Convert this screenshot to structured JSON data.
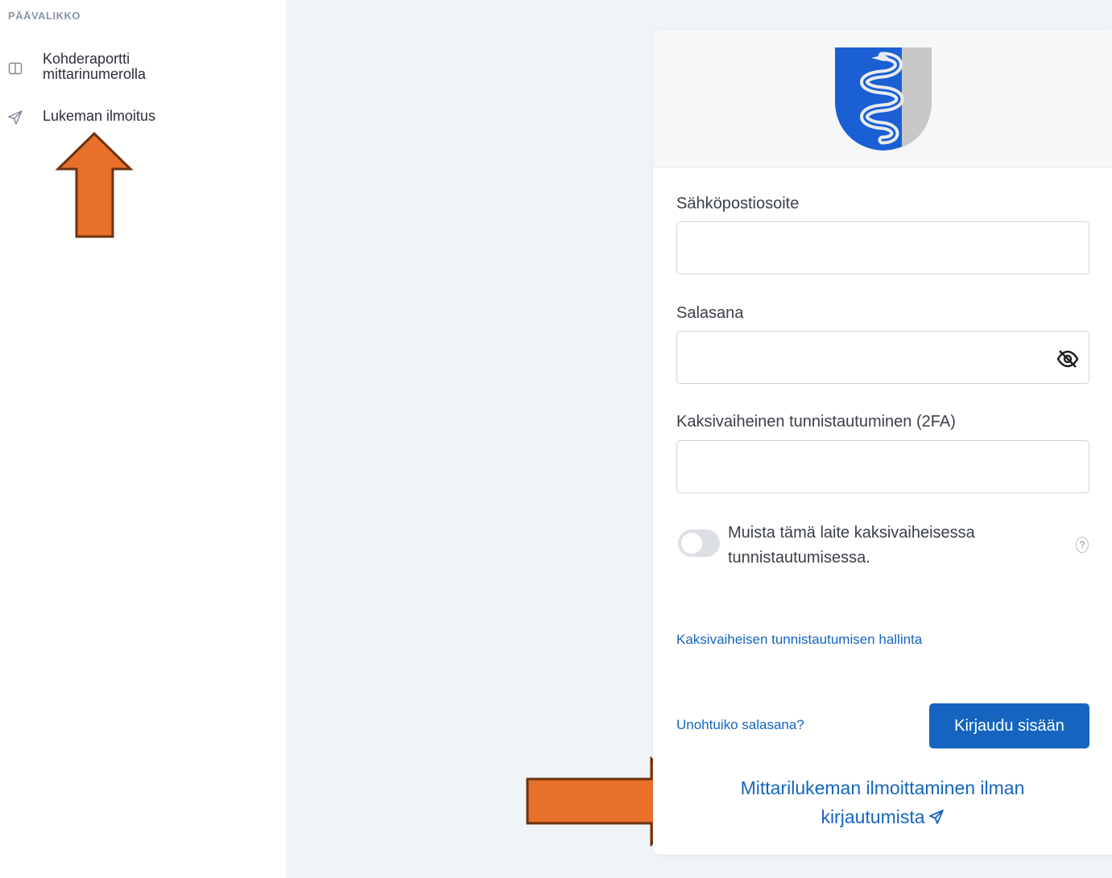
{
  "sidebar": {
    "heading": "PÄÄVALIKKO",
    "items": [
      {
        "label_line1": "Kohderaportti",
        "label_line2": "mittarinumerolla",
        "icon": "columns-icon"
      },
      {
        "label": "Lukeman ilmoitus",
        "icon": "send-icon"
      }
    ]
  },
  "login": {
    "email_label": "Sähköpostiosoite",
    "email_value": "",
    "password_label": "Salasana",
    "password_value": "",
    "twofa_label": "Kaksivaiheinen tunnistautuminen (2FA)",
    "twofa_value": "",
    "remember_label": "Muista tämä laite kaksivaiheisessa tunnistautumisessa.",
    "remember_enabled": false,
    "help_symbol": "?",
    "manage_2fa_link": "Kaksivaiheisen tunnistautumisen hallinta",
    "forgot_password_link": "Unohtuiko salasana?",
    "login_button": "Kirjaudu sisään",
    "no_login_link": "Mittarilukeman ilmoittaminen ilman kirjautumista"
  },
  "colors": {
    "primary": "#1565c0",
    "annotation_arrow": "#e8702a",
    "annotation_outline": "#6b3410",
    "crest_blue": "#1a5fd4",
    "crest_silver": "#c8c8c8",
    "background": "#f0f3f8"
  }
}
